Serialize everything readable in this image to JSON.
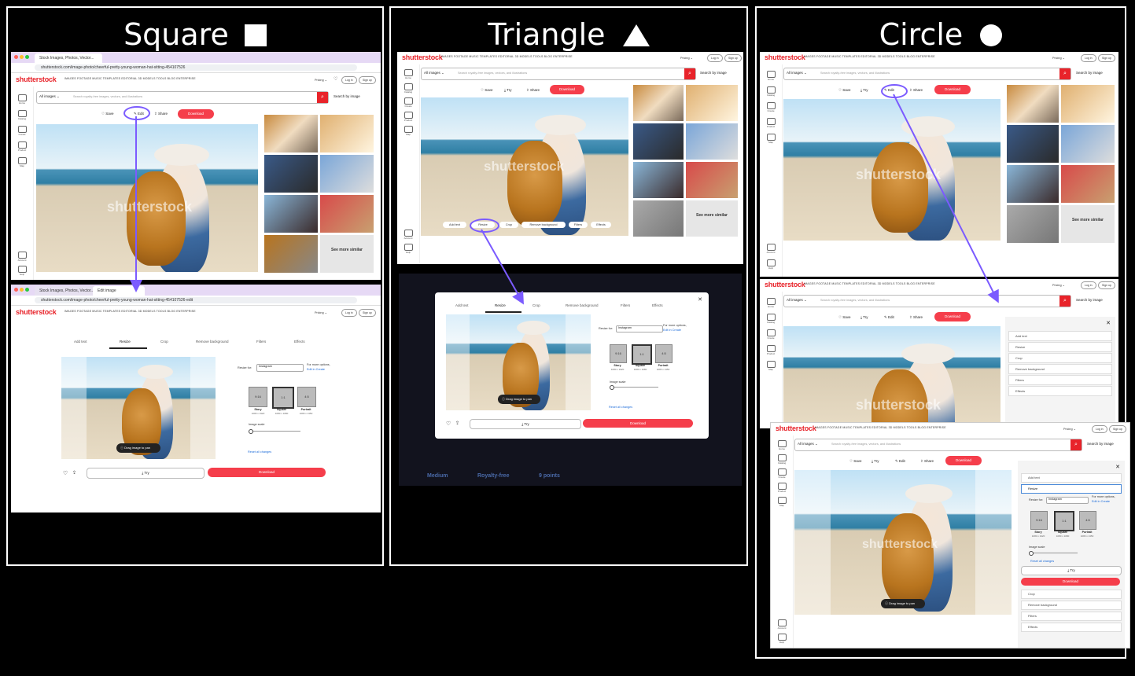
{
  "panels": [
    {
      "title": "Square",
      "icon": "square-icon"
    },
    {
      "title": "Triangle",
      "icon": "triangle-icon"
    },
    {
      "title": "Circle",
      "icon": "circle-icon"
    }
  ],
  "browser": {
    "tab1": "Stock Images, Photos, Vector...",
    "tab2": "Edit image",
    "url1": "shutterstock.com/image-photo/cheerful-pretty-young-woman-hat-sitting-454107526",
    "url2": "shutterstock.com/image-photo/cheerful-pretty-young-woman-hat-sitting-454107526-edit"
  },
  "site": {
    "logo": "shutterstock",
    "nav": "IMAGES    FOOTAGE    MUSIC    TEMPLATES    EDITORIAL    3D MODELS    TOOLS    BLOG    ENTERPRISE",
    "pricing": "Pricing ⌄",
    "login": "Log in",
    "signup": "Sign up",
    "search_category": "All images ⌄",
    "search_placeholder": "Search royalty-free images, vectors, and illustrations",
    "search_by_image": "Search by image"
  },
  "sidebar": [
    "Home",
    "Catalog",
    "Create",
    "Product",
    "Map",
    "Account",
    "Help"
  ],
  "actions": {
    "save": "♡ Save",
    "try": "⤓ Try",
    "edit": "✎ Edit",
    "share": "⇪ Share",
    "download": "Download"
  },
  "watermark": "shutterstock",
  "see_more": "See more similar",
  "editor": {
    "tools": [
      "Add text",
      "Resize",
      "Crop",
      "Remove background",
      "Filters",
      "Effects"
    ],
    "resize_for_label": "Resize for:",
    "resize_for_value": "Instagram",
    "more_options": "For more options,",
    "edit_in_create": "Edit in Create",
    "ratios": [
      {
        "ratio": "9:16",
        "name": "Story",
        "size": "1080 x 1920"
      },
      {
        "ratio": "1:1",
        "name": "Square",
        "size": "1080 x 1080"
      },
      {
        "ratio": "4:5",
        "name": "Portrait",
        "size": "1080 x 1350"
      }
    ],
    "image_scale": "Image scale",
    "reset": "Reset all changes",
    "drag": "Drag image to pan",
    "try": "⤓ Try",
    "download": "Download"
  },
  "bg_info": {
    "size": "Medium",
    "license": "Royalty-free",
    "points": "9 points"
  },
  "colors": {
    "accent": "#7b5bff",
    "brand": "#e8232a",
    "download": "#f53e4b"
  }
}
